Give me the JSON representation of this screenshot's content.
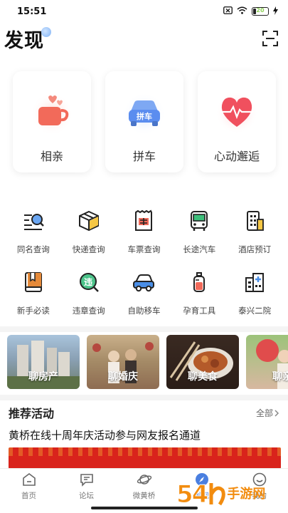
{
  "status_bar": {
    "time": "15:51",
    "battery_text": "20"
  },
  "header": {
    "title": "发现"
  },
  "feature_cards": [
    {
      "label": "相亲",
      "icon": "cup-heart-icon"
    },
    {
      "label": "拼车",
      "icon": "car-icon"
    },
    {
      "label": "心动邂逅",
      "icon": "heart-pulse-icon"
    }
  ],
  "grid": [
    {
      "label": "同名查询",
      "icon": "name-search-icon"
    },
    {
      "label": "快递查询",
      "icon": "package-icon"
    },
    {
      "label": "车票查询",
      "icon": "ticket-icon"
    },
    {
      "label": "长途汽车",
      "icon": "bus-icon"
    },
    {
      "label": "酒店预订",
      "icon": "hotel-icon"
    },
    {
      "label": "新手必读",
      "icon": "book-icon"
    },
    {
      "label": "违章查询",
      "icon": "violation-icon"
    },
    {
      "label": "自助移车",
      "icon": "move-car-icon"
    },
    {
      "label": "孕育工具",
      "icon": "baby-bottle-icon"
    },
    {
      "label": "泰兴二院",
      "icon": "hospital-icon"
    }
  ],
  "image_strip": [
    {
      "label": "聊房产"
    },
    {
      "label": "聊婚庆"
    },
    {
      "label": "聊美食"
    },
    {
      "label": "聊亲"
    }
  ],
  "recommended": {
    "title": "推荐活动",
    "all_label": "全部",
    "item": "黄桥在线十周年庆活动参与网友报名通道"
  },
  "bottom_nav": [
    {
      "label": "首页",
      "icon": "home-icon"
    },
    {
      "label": "论坛",
      "icon": "forum-icon"
    },
    {
      "label": "微黄桥",
      "icon": "planet-icon"
    },
    {
      "label": "发现",
      "icon": "compass-icon"
    },
    {
      "label": "我的",
      "icon": "profile-icon"
    }
  ],
  "watermark": {
    "number": "54",
    "text": "手游网"
  },
  "colors": {
    "accent": "#f05a5a",
    "blue": "#5b8def",
    "watermark": "#f28c0f"
  }
}
